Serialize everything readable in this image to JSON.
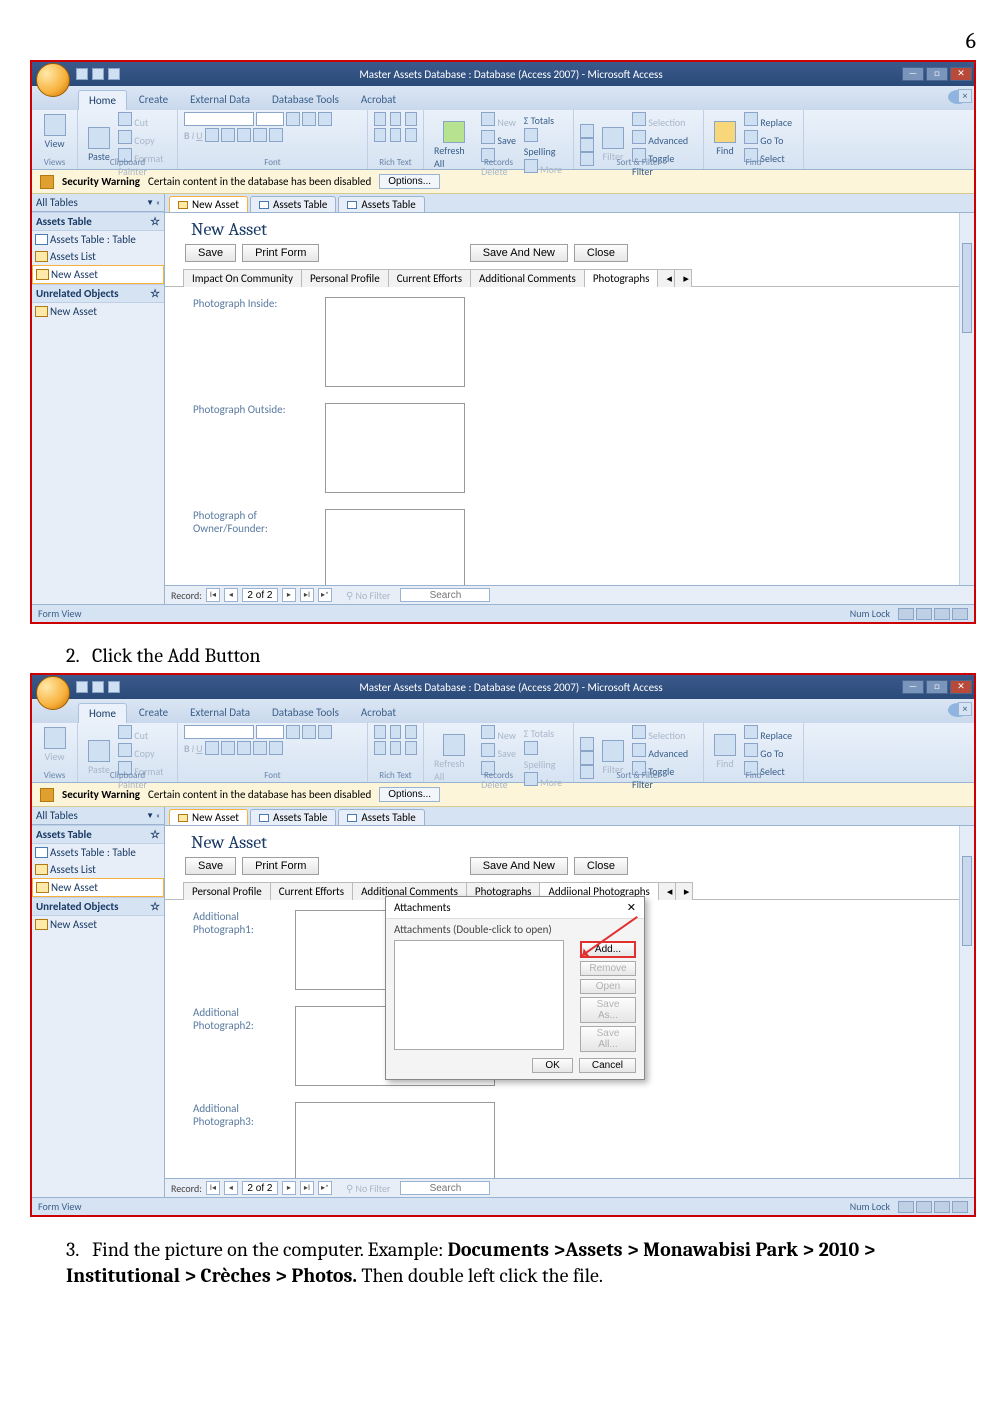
{
  "page_number": "6",
  "app": {
    "title": "Master Assets Database : Database (Access 2007) - Microsoft Access",
    "tabs": [
      "Home",
      "Create",
      "External Data",
      "Database Tools",
      "Acrobat"
    ],
    "active_tab": "Home",
    "ribbon_groups": {
      "views": "Views",
      "clipboard": "Clipboard",
      "font": "Font",
      "richtext": "Rich Text",
      "records": "Records",
      "sortfilter": "Sort & Filter",
      "find": "Find"
    },
    "ribbon_items": {
      "view": "View",
      "paste": "Paste",
      "cut": "Cut",
      "copy": "Copy",
      "fmt": "Format Painter",
      "refresh": "Refresh All",
      "new": "New",
      "save": "Save",
      "delete": "Delete",
      "totals": "Totals",
      "spelling": "Spelling",
      "more": "More",
      "filter": "Filter",
      "selection": "Selection",
      "advanced": "Advanced",
      "toggle": "Toggle Filter",
      "find": "Find",
      "replace": "Replace",
      "goto": "Go To",
      "select": "Select"
    },
    "security_warning": {
      "label": "Security Warning",
      "text": "Certain content in the database has been disabled",
      "button": "Options..."
    },
    "nav": {
      "header": "All Tables",
      "group1": "Assets Table",
      "items1": [
        "Assets Table : Table",
        "Assets List",
        "New Asset"
      ],
      "group2": "Unrelated Objects",
      "items2": [
        "New Asset"
      ]
    },
    "doc_tabs": [
      {
        "label": "New Asset",
        "active": true
      },
      {
        "label": "Assets Table"
      },
      {
        "label": "Assets Table"
      }
    ],
    "form": {
      "title": "New Asset",
      "buttons": {
        "save": "Save",
        "print": "Print Form",
        "savenew": "Save And New",
        "close": "Close"
      },
      "tabs1": [
        "Impact On Community",
        "Personal Profile",
        "Current Efforts",
        "Additional Comments",
        "Photographs"
      ],
      "active1": "Photographs",
      "fields1": [
        "Photograph Inside:",
        "Photograph Outside:",
        "Photograph of Owner/Founder:"
      ],
      "tabs2": [
        "Personal Profile",
        "Current Efforts",
        "Additional Comments",
        "Photographs",
        "Addiional Photographs"
      ],
      "active2": "Addiional Photographs",
      "fields2": [
        "Additional Photograph1:",
        "Additional Photograph2:",
        "Additional Photograph3:"
      ]
    },
    "recordnav": {
      "label": "Record:",
      "pos": "2 of 2",
      "nofilter": "No Filter",
      "search": "Search"
    },
    "status": {
      "left": "Form View",
      "right": "Num Lock"
    }
  },
  "dialog": {
    "title": "Attachments",
    "close": "✕",
    "subtitle": "Attachments (Double-click to open)",
    "buttons": {
      "add": "Add...",
      "remove": "Remove",
      "open": "Open",
      "saveas": "Save As...",
      "saveall": "Save All..."
    },
    "ok": "OK",
    "cancel": "Cancel"
  },
  "steps": {
    "s2": {
      "num": "2.",
      "text": "Click the Add Button"
    },
    "s3": {
      "num": "3.",
      "pre": "Find the picture on the computer. Example: ",
      "bold": "Documents >Assets > Monawabisi Park > 2010 > Institutional > Crèches > Photos.",
      "post": " Then double left click the file."
    }
  }
}
